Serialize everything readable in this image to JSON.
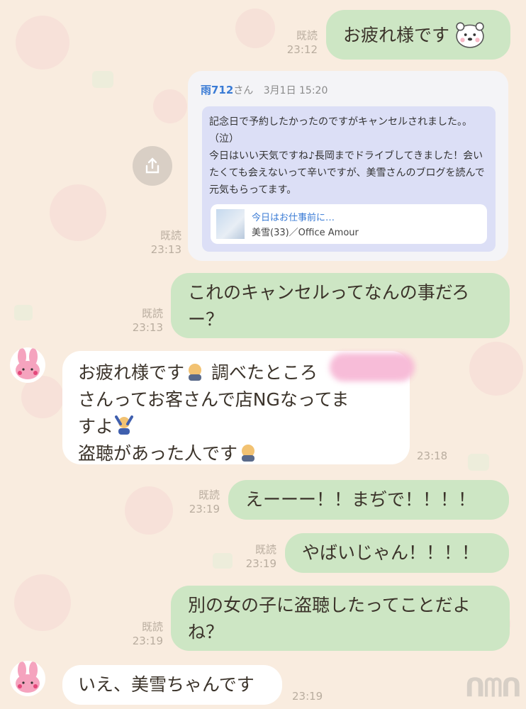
{
  "messages": {
    "m1": {
      "text": "お疲れ様です",
      "read": "既読",
      "time": "23:12"
    },
    "m2": {
      "read": "既読",
      "time": "23:13"
    },
    "m3": {
      "text": "これのキャンセルってなんの事だろー？",
      "read": "既読",
      "time": "23:13"
    },
    "m4": {
      "line1": "お疲れ様です",
      "line1b": "調べたところ",
      "line2": "さんってお客さんで店NGなってま",
      "line3": "すよ",
      "line4": "盗聴があった人です",
      "time": "23:18"
    },
    "m5": {
      "text": "えーーー！！まぢで！！！！",
      "read": "既読",
      "time": "23:19"
    },
    "m6": {
      "text": "やばいじゃん！！！！",
      "read": "既読",
      "time": "23:19"
    },
    "m7": {
      "text": "別の女の子に盗聴したってことだよね？",
      "read": "既読",
      "time": "23:19"
    },
    "m8": {
      "text": "いえ、美雪ちゃんです",
      "time": "23:19"
    }
  },
  "card": {
    "name": "雨712",
    "suffix": "さん",
    "date": "3月1日 15:20",
    "body": "記念日で予約したかったのですがキャンセルされました。。（泣）\n今日はいい天気ですね♪長岡までドライブしてきました！会いたくても会えないって辛いですが、美雪さんのブログを読んで元気もらってます。",
    "link_title": "今日はお仕事前に…",
    "link_sub": "美雪(33)／Office Amour"
  },
  "icons": {
    "share": "share-icon",
    "avatar": "rabbit-avatar"
  },
  "colors": {
    "outgoing": "#cde6c4",
    "incoming": "#ffffff",
    "background": "#f9ecdf"
  }
}
